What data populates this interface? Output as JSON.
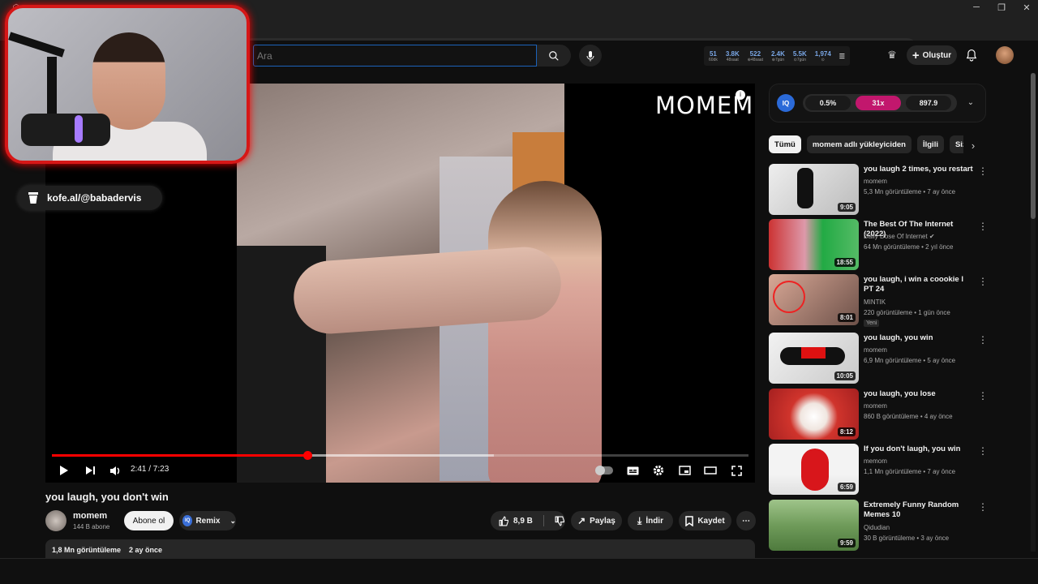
{
  "browser": {
    "minimize": "─",
    "restore": "❐",
    "close": "✕"
  },
  "header": {
    "search_placeholder": "Ara",
    "stats": [
      {
        "value": "51",
        "label": "60dk"
      },
      {
        "value": "3.8K",
        "label": "48saat"
      },
      {
        "value": "522",
        "label": "⊕48saat"
      },
      {
        "value": "2.4K",
        "label": "⊕7gün"
      },
      {
        "value": "5.5K",
        "label": "⊙7gün"
      },
      {
        "value": "1,974",
        "label": "⊙"
      }
    ],
    "create_label": "Oluştur"
  },
  "overlay": {
    "kofe_text": "kofe.al/@babadervis"
  },
  "player": {
    "logo_text": "MOMEM",
    "time": "2:41 / 7:23",
    "progress": 0.3664,
    "buffered": 0.634
  },
  "video": {
    "title": "you laugh, you don't win",
    "channel": "momem",
    "subs": "144 B abone",
    "subscribe_label": "Abone ol",
    "remix_label": "Remix",
    "likes": "8,9 B",
    "share_label": "Paylaş",
    "download_label": "İndir",
    "save_label": "Kaydet",
    "views": "1,8 Mn görüntüleme",
    "date": "2 ay önce"
  },
  "sidebar": {
    "iq_badge": "IQ",
    "iq_values": [
      "0.5%",
      "31x",
      "897.9"
    ],
    "chips": [
      "Tümü",
      "momem adlı yükleyiciden",
      "İlgili",
      "Sizi"
    ],
    "items": [
      {
        "title": "you laugh 2 times, you restart",
        "channel": "momem",
        "meta": "5,3 Mn görüntüleme • 7 ay önce",
        "duration": "9:05",
        "tag": ""
      },
      {
        "title": "The Best Of The Internet (2022)",
        "channel": "Daily Dose Of Internet ✔",
        "meta": "64 Mn görüntüleme • 2 yıl önce",
        "duration": "18:55",
        "tag": ""
      },
      {
        "title": "you laugh, i win a coookie l PT 24",
        "channel": "MINTIK",
        "meta": "220 görüntüleme • 1 gün önce",
        "duration": "8:01",
        "tag": "Yeni"
      },
      {
        "title": "you laugh, you win",
        "channel": "momem",
        "meta": "6,9 Mn görüntüleme • 5 ay önce",
        "duration": "10:05",
        "tag": ""
      },
      {
        "title": "you laugh, you lose",
        "channel": "momem",
        "meta": "860 B görüntüleme • 4 ay önce",
        "duration": "8:12",
        "tag": ""
      },
      {
        "title": "If you don't laugh, you win",
        "channel": "memom",
        "meta": "1,1 Mn görüntüleme • 7 ay önce",
        "duration": "6:59",
        "tag": ""
      },
      {
        "title": "Extremely Funny Random Memes 10",
        "channel": "Qidudian",
        "meta": "30 B görüntüleme • 3 ay önce",
        "duration": "9:59",
        "tag": ""
      }
    ]
  },
  "colors": {
    "accent": "#ff0000",
    "iq_blue": "#2b6ad8",
    "multiplier": "#c2176d",
    "cam_border": "#d61717"
  }
}
